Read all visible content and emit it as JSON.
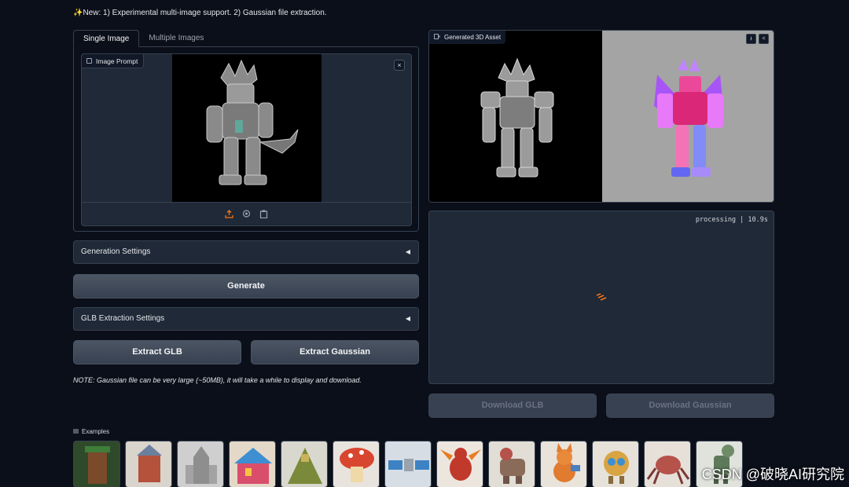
{
  "notice": "✨New: 1) Experimental multi-image support. 2) Gaussian file extraction.",
  "tabs": [
    {
      "label": "Single Image",
      "active": true
    },
    {
      "label": "Multiple Images",
      "active": false
    }
  ],
  "image_prompt": {
    "label": "Image Prompt",
    "close_icon": "×",
    "upload_buttons": [
      "upload-icon",
      "webcam-icon",
      "clipboard-icon"
    ]
  },
  "generation_settings": {
    "label": "Generation Settings",
    "arrow": "◀"
  },
  "generate_button": "Generate",
  "glb_settings": {
    "label": "GLB Extraction Settings",
    "arrow": "◀"
  },
  "extract_glb_button": "Extract GLB",
  "extract_gaussian_button": "Extract Gaussian",
  "note": "NOTE: Gaussian file can be very large (~50MB), it will take a while to display and download.",
  "video": {
    "label": "Generated 3D Asset",
    "download_icon": "⭳",
    "share_icon": "<"
  },
  "model": {
    "progress": "processing | 10.9s"
  },
  "download_glb_button": "Download GLB",
  "download_gaussian_button": "Download Gaussian",
  "examples": {
    "label": "Examples",
    "items": [
      "vine-tower",
      "red-brick-house",
      "stone-castle",
      "colorful-house",
      "pyramid-temple",
      "mushroom-house",
      "satellite",
      "red-dragon",
      "elephant-robot",
      "fox-creature",
      "round-robot",
      "crab-robot",
      "dinosaur-mech"
    ]
  },
  "watermark": "CSDN @破晓AI研究院",
  "colors": {
    "background": "#0b0f19",
    "panel": "#1f2937",
    "border": "#374151",
    "accent": "#f97316"
  }
}
